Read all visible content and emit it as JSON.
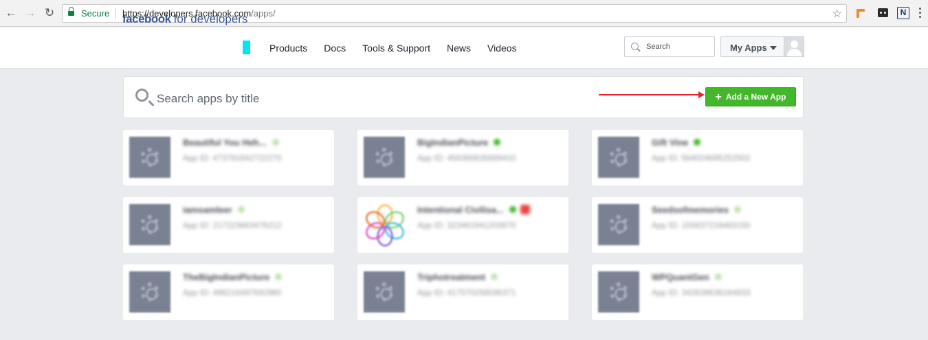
{
  "browser": {
    "secure_label": "Secure",
    "url_host": "https://developers.facebook.com",
    "url_path": "/apps/",
    "ext_n_label": "N"
  },
  "header": {
    "brand_main": "facebook",
    "brand_sub": "for developers",
    "nav": [
      "Products",
      "Docs",
      "Tools & Support",
      "News",
      "Videos"
    ],
    "search_placeholder": "Search",
    "my_apps_label": "My Apps"
  },
  "apps_bar": {
    "search_placeholder": "Search apps by title",
    "add_button_label": "Add a New App"
  },
  "apps": [
    {
      "title": "Beautiful You Heh...",
      "app_id": "App ID: 473791642722270",
      "status_color": "#bfe3b1",
      "icon": "gear-icon"
    },
    {
      "title": "BigIndianPicture",
      "app_id": "App ID: 456366635669410",
      "status_color": "#42b72a",
      "icon": "gear-icon"
    },
    {
      "title": "Gift Vine",
      "app_id": "App ID: 564024695252502",
      "status_color": "#42b72a",
      "icon": "gear-icon"
    },
    {
      "title": "iamsamleer",
      "app_id": "App ID: 217223663476212",
      "status_color": "#bfe3b1",
      "icon": "gear-icon"
    },
    {
      "title": "Intentional Civilisa...",
      "app_id": "App ID: 323461941203670",
      "status_color": "#42b72a",
      "alert": true,
      "icon": "flower-icon"
    },
    {
      "title": "Seedsofmemories",
      "app_id": "App ID: 155637216463150",
      "status_color": "#bfe3b1",
      "icon": "gear-icon"
    },
    {
      "title": "TheBigIndianPicture",
      "app_id": "App ID: 496216497692960",
      "status_color": "#bfe3b1",
      "icon": "gear-icon"
    },
    {
      "title": "Triphotreatment",
      "app_id": "App ID: 417570256596371",
      "status_color": "#bfe3b1",
      "icon": "gear-icon"
    },
    {
      "title": "WPQuantGen",
      "app_id": "App ID: 342639636164833",
      "status_color": "#bfe3b1",
      "icon": "gear-icon"
    }
  ],
  "colors": {
    "brand": "#3b5998",
    "accent_green": "#42b72a",
    "annotation_arrow": "#e8232f",
    "cyan_marker": "#00e5ee"
  }
}
